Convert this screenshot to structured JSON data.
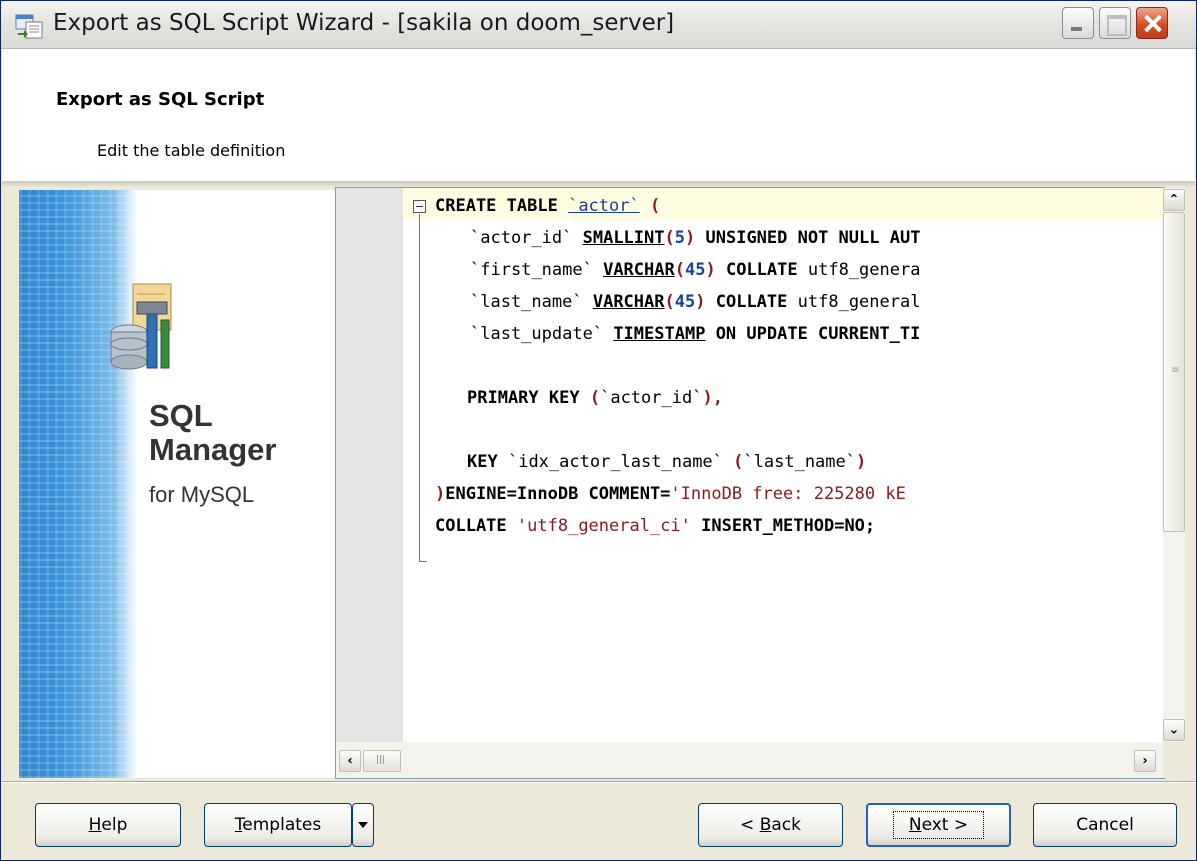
{
  "window": {
    "title": "Export as SQL Script Wizard - [sakila on doom_server]"
  },
  "header": {
    "title": "Export as SQL Script",
    "subtitle": "Edit the table definition"
  },
  "banner": {
    "brand_line1": "SQL",
    "brand_line2": "Manager",
    "brand_line3": "for MySQL"
  },
  "editor": {
    "l1": {
      "a": "CREATE TABLE",
      "b": "`actor`",
      "c": "("
    },
    "l2": {
      "a": "`actor_id`",
      "b": "SMALLINT",
      "c": "(",
      "d": "5",
      "e": ")",
      "f": "UNSIGNED NOT NULL AUT"
    },
    "l3": {
      "a": "`first_name`",
      "b": "VARCHAR",
      "c": "(",
      "d": "45",
      "e": ")",
      "f": "COLLATE",
      "g": "utf8_genera"
    },
    "l4": {
      "a": "`last_name`",
      "b": "VARCHAR",
      "c": "(",
      "d": "45",
      "e": ")",
      "f": "COLLATE",
      "g": "utf8_general"
    },
    "l5": {
      "a": "`last_update`",
      "b": "TIMESTAMP",
      "c": "ON UPDATE CURRENT_TI"
    },
    "l7": {
      "a": "PRIMARY KEY",
      "b": "(",
      "c": "`actor_id`",
      "d": "),",
      "e": ""
    },
    "l9": {
      "a": "KEY",
      "b": "`idx_actor_last_name`",
      "c": "(",
      "d": "`last_name`",
      "e": ")"
    },
    "l10": {
      "a": ")",
      "b": "ENGINE=InnoDB COMMENT=",
      "c": "'InnoDB free: 225280 kE"
    },
    "l11": {
      "a": "COLLATE",
      "b": "'utf8_general_ci'",
      "c": "INSERT_METHOD=NO;"
    }
  },
  "buttons": {
    "help": {
      "mnemonic": "H",
      "rest": "elp"
    },
    "templates": {
      "mnemonic": "T",
      "rest": "emplates"
    },
    "back": {
      "prefix": "< ",
      "mnemonic": "B",
      "rest": "ack"
    },
    "next": {
      "mnemonic": "N",
      "rest": "ext >"
    },
    "cancel": "Cancel"
  },
  "icons": {
    "title_icon": "export-sql-icon",
    "minimize": "minimize-icon",
    "maximize": "maximize-icon",
    "close": "close-icon",
    "logo": "sql-manager-logo-icon"
  }
}
